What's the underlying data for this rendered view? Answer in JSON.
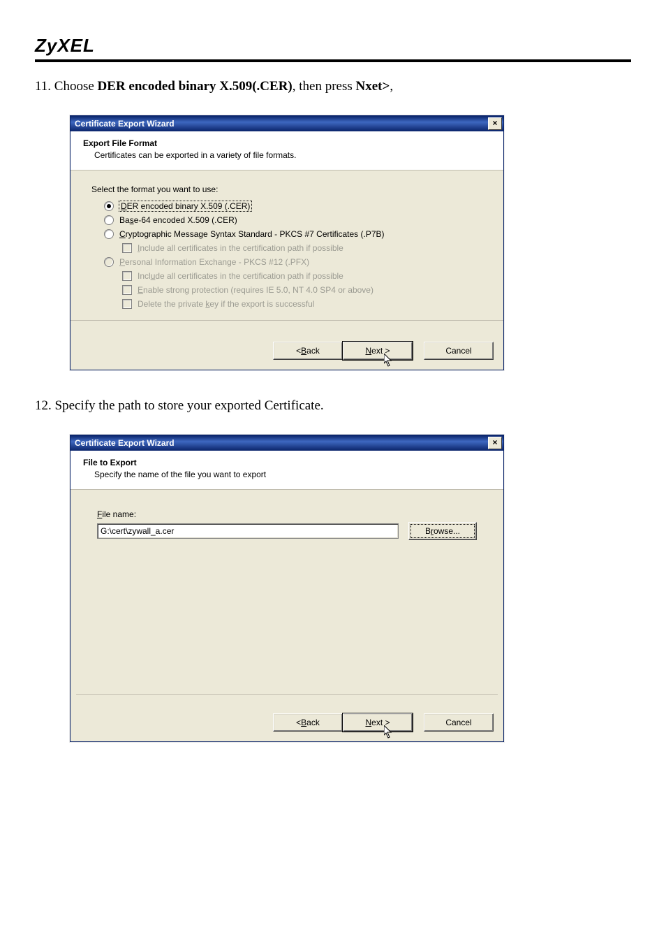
{
  "brand": "ZyXEL",
  "step11": {
    "prefix": "11. Choose ",
    "bold1": "DER encoded binary X.509(.CER)",
    "mid": ", then press ",
    "bold2": "Nxet>",
    "suffix": ","
  },
  "step12": "12. Specify the path to store your exported Certificate.",
  "dialog_title": "Certificate Export Wizard",
  "close_glyph": "×",
  "dlg1": {
    "head_title": "Export File Format",
    "head_sub": "Certificates can be exported in a variety of file formats.",
    "section": "Select the format you want to use:",
    "opt_der_pre": "D",
    "opt_der_rest": "ER encoded binary X.509 (.CER)",
    "opt_b64_pre": "Ba",
    "opt_b64_u": "s",
    "opt_b64_rest": "e-64 encoded X.509 (.CER)",
    "opt_p7b_u": "C",
    "opt_p7b_rest": "ryptographic Message Syntax Standard - PKCS #7 Certificates (.P7B)",
    "sub_inc1_u": "I",
    "sub_inc1_rest": "nclude all certificates in the certification path if possible",
    "opt_pfx_u": "P",
    "opt_pfx_rest": "ersonal Information Exchange - PKCS #12 (.PFX)",
    "sub_inc2_pre": "Incl",
    "sub_inc2_u": "u",
    "sub_inc2_rest": "de all certificates in the certification path if possible",
    "sub_prot_u": "E",
    "sub_prot_rest": "nable strong protection (requires IE 5.0, NT 4.0 SP4 or above)",
    "sub_del_pre": "Delete the private ",
    "sub_del_u": "k",
    "sub_del_rest": "ey if the export is successful"
  },
  "dlg2": {
    "head_title": "File to Export",
    "head_sub": "Specify the name of the file you want to export",
    "file_label_u": "F",
    "file_label_rest": "ile name:",
    "file_value": "G:\\cert\\zywall_a.cer",
    "browse_pre": "B",
    "browse_u": "r",
    "browse_rest": "owse..."
  },
  "buttons": {
    "back_pre": "< ",
    "back_u": "B",
    "back_rest": "ack",
    "next_u": "N",
    "next_rest": "ext >",
    "cancel": "Cancel"
  }
}
